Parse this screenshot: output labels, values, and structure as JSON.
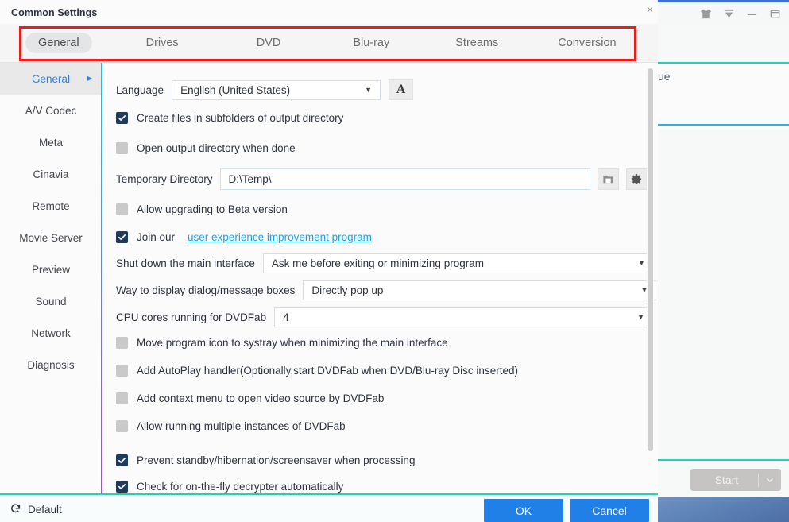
{
  "background_app": {
    "titlebar_icons": [
      "theme-shirt-icon",
      "download-icon",
      "minimize-icon",
      "maximize-icon"
    ],
    "panel_text_fragment": "ue",
    "start_button": {
      "label": "Start",
      "enabled": false,
      "chevron": "chevron-down-icon"
    }
  },
  "dialog": {
    "title": "Common Settings",
    "close_label": "×",
    "tabs": [
      {
        "id": "general",
        "label": "General",
        "active": true
      },
      {
        "id": "drives",
        "label": "Drives",
        "active": false
      },
      {
        "id": "dvd",
        "label": "DVD",
        "active": false
      },
      {
        "id": "bluray",
        "label": "Blu-ray",
        "active": false
      },
      {
        "id": "streams",
        "label": "Streams",
        "active": false
      },
      {
        "id": "conversion",
        "label": "Conversion",
        "active": false
      }
    ],
    "annotation": {
      "color": "#ee1b1b",
      "shape": "rectangle",
      "target": "tab-bar"
    },
    "sidebar": [
      {
        "id": "general",
        "label": "General",
        "active": true,
        "arrow": true
      },
      {
        "id": "av-codec",
        "label": "A/V Codec",
        "active": false,
        "arrow": false
      },
      {
        "id": "meta",
        "label": "Meta",
        "active": false,
        "arrow": false
      },
      {
        "id": "cinavia",
        "label": "Cinavia",
        "active": false,
        "arrow": false
      },
      {
        "id": "remote",
        "label": "Remote",
        "active": false,
        "arrow": false
      },
      {
        "id": "movie-server",
        "label": "Movie Server",
        "active": false,
        "arrow": false
      },
      {
        "id": "preview",
        "label": "Preview",
        "active": false,
        "arrow": false
      },
      {
        "id": "sound",
        "label": "Sound",
        "active": false,
        "arrow": false
      },
      {
        "id": "network",
        "label": "Network",
        "active": false,
        "arrow": false
      },
      {
        "id": "diagnosis",
        "label": "Diagnosis",
        "active": false,
        "arrow": false
      }
    ],
    "settings": {
      "language": {
        "label": "Language",
        "value": "English (United States)",
        "font_button_label": "A"
      },
      "create_subfolders": {
        "label": "Create files in subfolders of output directory",
        "checked": true
      },
      "open_output_dir": {
        "label": "Open output directory when done",
        "checked": false
      },
      "temporary_directory": {
        "label": "Temporary Directory",
        "value": "D:\\Temp\\",
        "browse_icon": "folder-icon",
        "settings_icon": "gear-icon"
      },
      "allow_beta": {
        "label": "Allow upgrading to Beta version",
        "checked": false
      },
      "join_program": {
        "prefix": "Join our",
        "link_label": "user experience improvement program",
        "checked": true
      },
      "shutdown_main_interface": {
        "label": "Shut down the main interface",
        "value": "Ask me before exiting or minimizing program"
      },
      "dialog_display_way": {
        "label": "Way to display dialog/message boxes",
        "value": "Directly pop up"
      },
      "cpu_cores": {
        "label": "CPU cores running for DVDFab",
        "value": "4"
      },
      "move_to_systray": {
        "label": "Move program icon to systray when minimizing the main interface",
        "checked": false
      },
      "autoplay_handler": {
        "label": "Add AutoPlay handler(Optionally,start DVDFab when DVD/Blu-ray Disc inserted)",
        "checked": false
      },
      "context_menu": {
        "label": "Add context menu to open video source by DVDFab",
        "checked": false
      },
      "multiple_instances": {
        "label": "Allow running multiple instances of DVDFab",
        "checked": false
      },
      "prevent_standby": {
        "label": "Prevent standby/hibernation/screensaver when processing",
        "checked": true
      },
      "check_decrypter": {
        "label": "Check for on-the-fly decrypter automatically",
        "checked": true
      }
    },
    "footer": {
      "default_label": "Default",
      "default_icon": "restore-arrow-icon",
      "ok_label": "OK",
      "cancel_label": "Cancel"
    }
  }
}
